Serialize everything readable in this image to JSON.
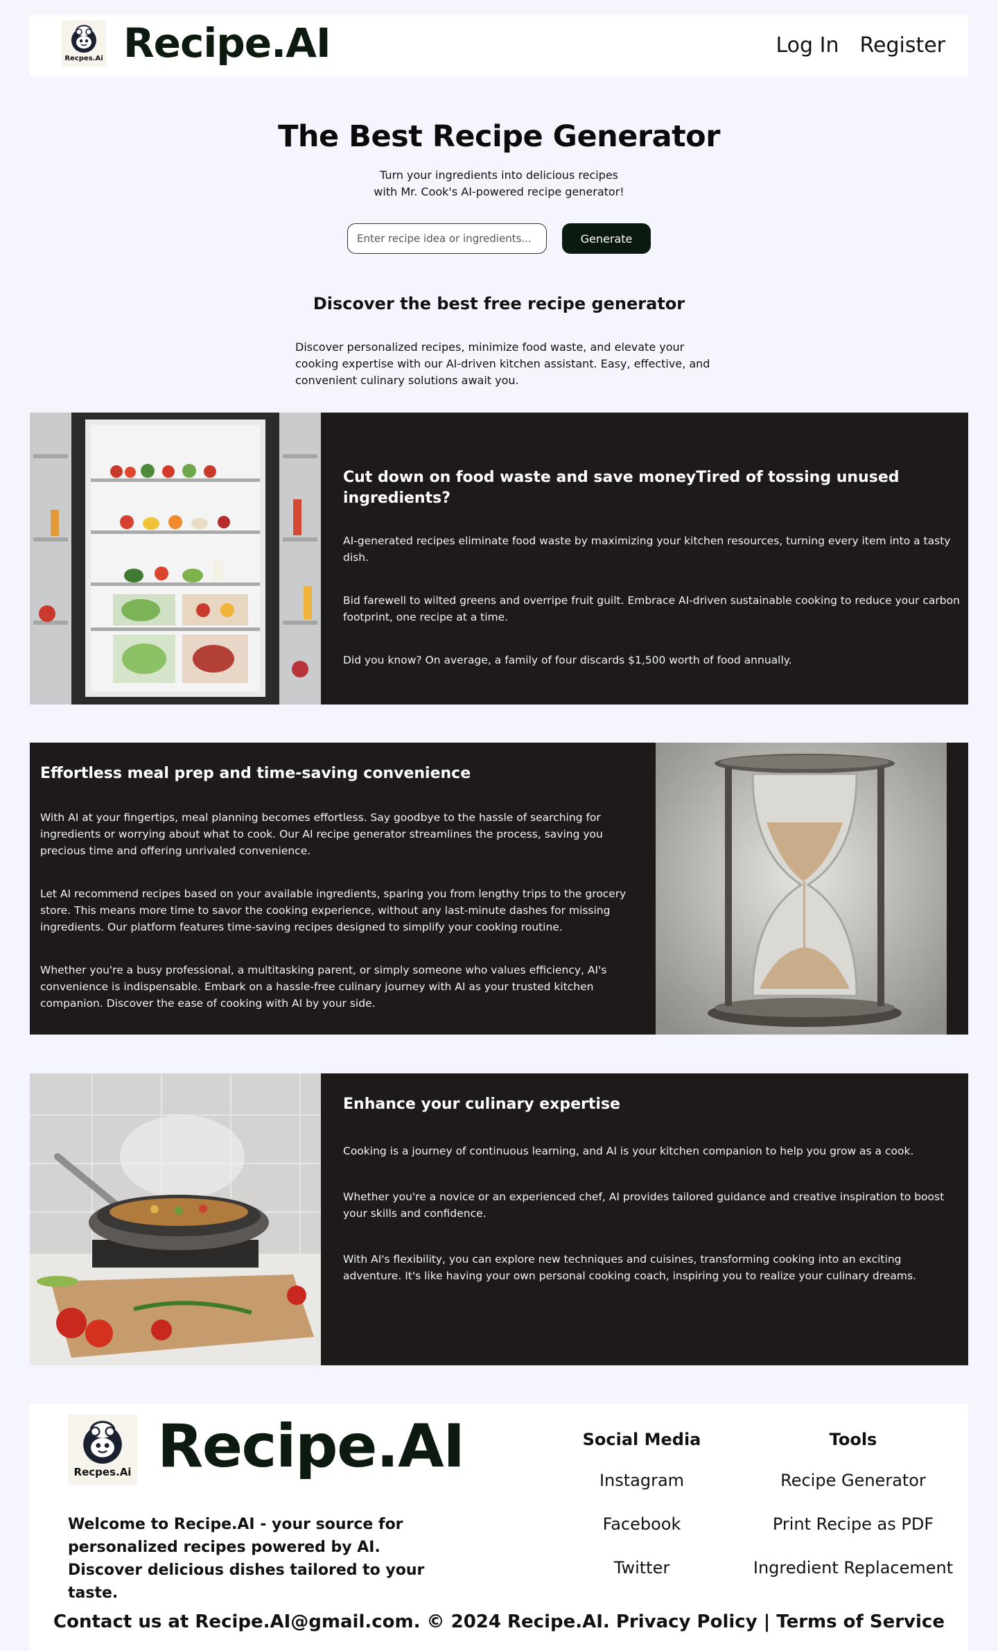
{
  "header": {
    "logo_caption": "Recpes.Ai",
    "brand": "Recipe.AI",
    "nav": {
      "login": "Log In",
      "register": "Register"
    }
  },
  "hero": {
    "title": "The Best Recipe Generator",
    "subtitle_line1": "Turn your ingredients into delicious recipes",
    "subtitle_line2": "with Mr. Cook's AI-powered recipe generator!",
    "search_placeholder": "Enter recipe idea or ingredients...",
    "generate_label": "Generate"
  },
  "discover": {
    "title": "Discover the best free recipe generator",
    "text": "Discover personalized recipes, minimize food waste, and elevate your cooking expertise with our AI-driven kitchen assistant. Easy, effective, and convenient culinary solutions await you."
  },
  "features": [
    {
      "title": "Cut down on food waste and save moneyTired of tossing unused ingredients?",
      "image": "open-refrigerator-image",
      "paragraphs": [
        "AI-generated recipes eliminate food waste by maximizing your kitchen resources, turning every item into a tasty dish.",
        "Bid farewell to wilted greens and overripe fruit guilt. Embrace AI-driven sustainable cooking to reduce your carbon footprint, one recipe at a time.",
        "Did you know? On average, a family of four discards $1,500 worth of food annually."
      ]
    },
    {
      "title": "Effortless meal prep and time-saving convenience",
      "image": "hourglass-image",
      "paragraphs": [
        "With AI at your fingertips, meal planning becomes effortless. Say goodbye to the hassle of searching for ingredients or worrying about what to cook. Our AI recipe generator streamlines the process, saving you precious time and offering unrivaled convenience.",
        "Let AI recommend recipes based on your available ingredients, sparing you from lengthy trips to the grocery store. This means more time to savor the cooking experience, without any last-minute dashes for missing ingredients. Our platform features time-saving recipes designed to simplify your cooking routine.",
        "Whether you're a busy professional, a multitasking parent, or simply someone who values efficiency, AI's convenience is indispensable. Embark on a hassle-free culinary journey with AI as your trusted kitchen companion. Discover the ease of cooking with AI by your side."
      ]
    },
    {
      "title": "Enhance your culinary expertise",
      "image": "cooking-pan-image",
      "paragraphs": [
        "Cooking is a journey of continuous learning, and AI is your kitchen companion to help you grow as a cook.",
        "Whether you're a novice or an experienced chef, AI provides tailored guidance and creative inspiration to boost your skills and confidence.",
        "With AI's flexibility, you can explore new techniques and cuisines, transforming cooking into an exciting adventure. It's like having your own personal cooking coach, inspiring you to realize your culinary dreams."
      ]
    }
  ],
  "footer": {
    "logo_caption": "Recpes.Ai",
    "brand": "Recipe.AI",
    "welcome": "Welcome to Recipe.AI - your source for personalized recipes powered by AI. Discover delicious dishes tailored to your taste.",
    "social": {
      "title": "Social Media",
      "links": [
        "Instagram",
        "Facebook",
        "Twitter"
      ]
    },
    "tools": {
      "title": "Tools",
      "links": [
        "Recipe Generator",
        "Print Recipe as PDF",
        "Ingredient Replacement"
      ]
    },
    "bottom": {
      "contact": "Contact us at Recipe.AI@gmail.com. © 2024 Recipe.AI.",
      "privacy": "Privacy Policy",
      "separator": "|",
      "terms": "Terms of Service"
    }
  },
  "colors": {
    "page_bg": "#f5f6fd",
    "section_bg": "#1e1a19",
    "brand_dark": "#0c1a10",
    "button_bg": "#0b1a10"
  }
}
